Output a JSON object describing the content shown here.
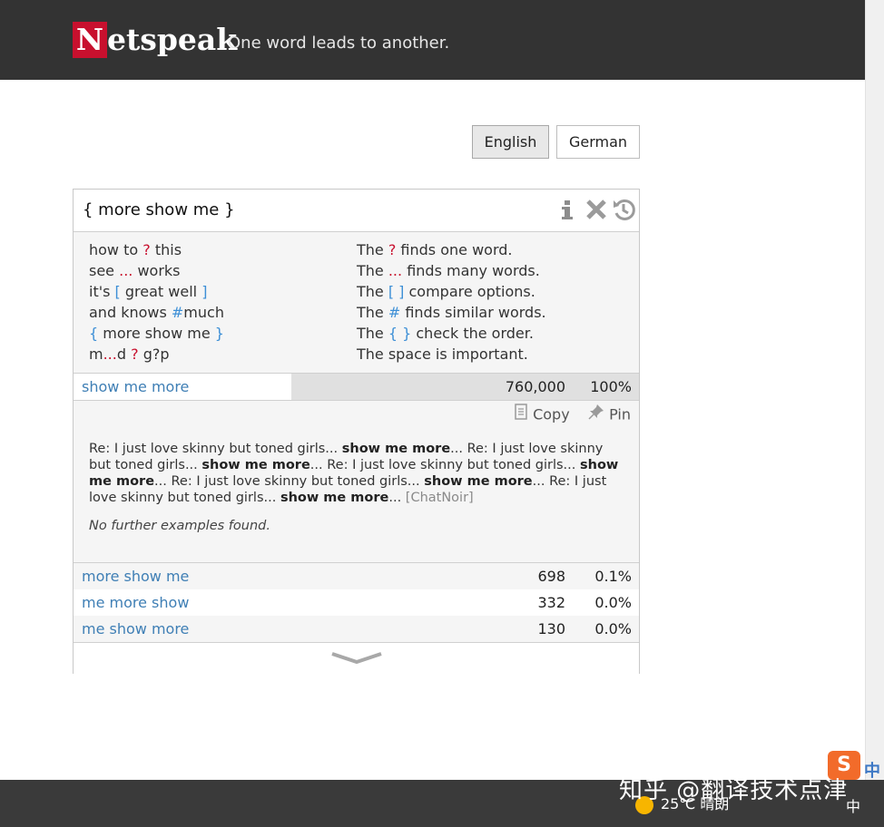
{
  "header": {
    "logo_initial": "N",
    "logo_rest": "etspeak",
    "slogan": "One word leads to another."
  },
  "languages": {
    "english": "English",
    "german": "German",
    "selected": "English"
  },
  "query": {
    "value": "{ more show me }",
    "icons": [
      "info-icon",
      "clear-icon",
      "history-icon"
    ]
  },
  "help": {
    "examples": [
      {
        "pre": "how to ",
        "op": "?",
        "post": " this",
        "op_color": "red"
      },
      {
        "pre": "see ",
        "op": "...",
        "post": " works",
        "op_color": "red"
      },
      {
        "pre": "it's ",
        "op": "[",
        "mid": " great well ",
        "op2": "]",
        "post": "",
        "op_color": "blue"
      },
      {
        "pre": "and knows ",
        "op": "#",
        "post": "much",
        "op_color": "blue"
      },
      {
        "pre": "",
        "op": "{",
        "mid": " more show me ",
        "op2": "}",
        "post": "",
        "op_color": "blue"
      },
      {
        "pre": "m",
        "op": "...",
        "mid": "d ",
        "op2": "?",
        "post": " g?p",
        "op_color": "red"
      }
    ],
    "explanations": [
      {
        "pre": "The ",
        "op": "?",
        "post": " finds one word.",
        "op_color": "red"
      },
      {
        "pre": "The ",
        "op": "...",
        "post": " finds many words.",
        "op_color": "red"
      },
      {
        "pre": "The ",
        "op": "[ ]",
        "post": " compare options.",
        "op_color": "blue"
      },
      {
        "pre": "The ",
        "op": "#",
        "post": " finds similar words.",
        "op_color": "blue"
      },
      {
        "pre": "The ",
        "op": "{ }",
        "post": " check the order.",
        "op_color": "blue"
      },
      {
        "pre": "The space is important.",
        "op": "",
        "post": "",
        "op_color": "none"
      }
    ]
  },
  "results": [
    {
      "phrase": "show me more",
      "frequency": "760,000",
      "percent": "100%",
      "share": 1.0
    },
    {
      "phrase": "more show me",
      "frequency": "698",
      "percent": "0.1%",
      "share": 0.001
    },
    {
      "phrase": "me more show",
      "frequency": "332",
      "percent": "0.0%",
      "share": 0.0
    },
    {
      "phrase": "me show more",
      "frequency": "130",
      "percent": "0.0%",
      "share": 0.0
    }
  ],
  "details": {
    "copy_label": "Copy",
    "pin_label": "Pin",
    "example_segments": [
      {
        "text": "Re: I just love skinny but toned girls... ",
        "bold": false
      },
      {
        "text": "show me more",
        "bold": true
      },
      {
        "text": "... Re: I just love skinny but toned girls... ",
        "bold": false
      },
      {
        "text": "show me more",
        "bold": true
      },
      {
        "text": "... Re: I just love skinny but toned girls... ",
        "bold": false
      },
      {
        "text": "show me more",
        "bold": true
      },
      {
        "text": "... Re: I just love skinny but toned girls... ",
        "bold": false
      },
      {
        "text": "show me more",
        "bold": true
      },
      {
        "text": "... Re: I just love skinny but toned girls... ",
        "bold": false
      },
      {
        "text": "show me more",
        "bold": true
      },
      {
        "text": "... ",
        "bold": false
      }
    ],
    "source": "[ChatNoir]",
    "no_more": "No further examples found."
  },
  "overlay": {
    "watermark": "知乎 @翻译技术点津",
    "weather": "25℃ 晴朗",
    "ime_logo": "S",
    "ime_zh": "中",
    "tray_ime": "中"
  },
  "colors": {
    "header_bg": "#333333",
    "brand_red": "#c8102e",
    "link_blue": "#3f7fb5",
    "operator_blue": "#3d8fd6"
  }
}
